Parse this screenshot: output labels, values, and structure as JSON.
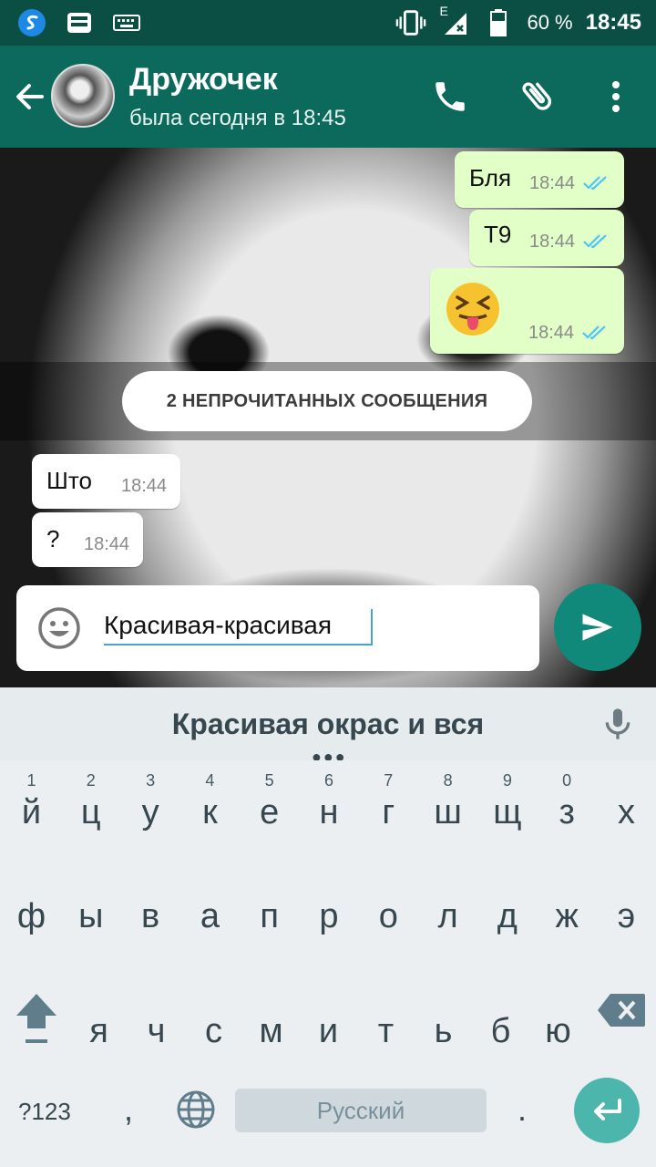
{
  "status_bar": {
    "network_type": "E",
    "battery": "60 %",
    "time": "18:45",
    "icons": [
      "s-app-icon",
      "inbox-tray-icon",
      "keyboard-icon",
      "vibrate-icon",
      "signal-icon",
      "battery-icon"
    ]
  },
  "header": {
    "contact_name": "Дружочек",
    "last_seen": "была сегодня в 18:45",
    "actions": [
      "phone-icon",
      "attach-icon",
      "more-icon"
    ]
  },
  "messages": [
    {
      "dir": "out",
      "text": "Бля",
      "time": "18:44",
      "status": "read"
    },
    {
      "dir": "out",
      "text": "Т9",
      "time": "18:44",
      "status": "read"
    },
    {
      "dir": "out",
      "emoji": "squinting-face-with-tongue",
      "time": "18:44",
      "status": "read"
    },
    {
      "dir": "in",
      "text": "Што",
      "time": "18:44"
    },
    {
      "dir": "in",
      "text": "?",
      "time": "18:44"
    }
  ],
  "unread_banner": "2 НЕПРОЧИТАННЫХ СООБЩЕНИЯ",
  "composer": {
    "text": "Красивая-красивая"
  },
  "colors": {
    "header": "#0c6a5d",
    "status_bar": "#0b4f44",
    "outgoing_bubble": "#e1ffc7",
    "send_button": "#11897a",
    "read_ticks": "#4fc3f7"
  },
  "keyboard": {
    "suggestion": "Красивая окрас и вся",
    "row1": [
      {
        "ch": "й",
        "hint": "1"
      },
      {
        "ch": "ц",
        "hint": "2"
      },
      {
        "ch": "у",
        "hint": "3"
      },
      {
        "ch": "к",
        "hint": "4"
      },
      {
        "ch": "е",
        "hint": "5"
      },
      {
        "ch": "н",
        "hint": "6"
      },
      {
        "ch": "г",
        "hint": "7"
      },
      {
        "ch": "ш",
        "hint": "8"
      },
      {
        "ch": "щ",
        "hint": "9"
      },
      {
        "ch": "з",
        "hint": "0"
      },
      {
        "ch": "х",
        "hint": ""
      }
    ],
    "row2": [
      "ф",
      "ы",
      "в",
      "а",
      "п",
      "р",
      "о",
      "л",
      "д",
      "ж",
      "э"
    ],
    "row3": [
      "я",
      "ч",
      "с",
      "м",
      "и",
      "т",
      "ь",
      "б",
      "ю"
    ],
    "symbols_label": "?123",
    "comma": ",",
    "space_label": "Русский",
    "period": "."
  }
}
